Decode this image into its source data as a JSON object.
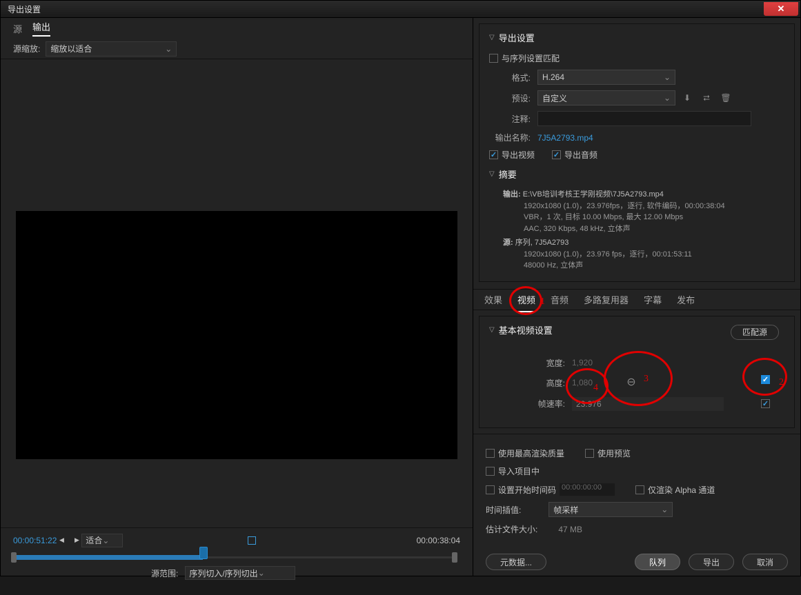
{
  "window": {
    "title": "导出设置"
  },
  "left": {
    "tabs": {
      "src": "源",
      "out": "输出"
    },
    "zoomLabel": "源缩放:",
    "zoomValue": "缩放以适合",
    "timeLeft": "00:00:51:22",
    "timeRight": "00:00:38:04",
    "fit": "适合",
    "rangeLabel": "源范围:",
    "rangeValue": "序列切入/序列切出"
  },
  "export": {
    "heading": "导出设置",
    "matchSeq": "与序列设置匹配",
    "formatLabel": "格式:",
    "formatValue": "H.264",
    "presetLabel": "预设:",
    "presetValue": "自定义",
    "commentLabel": "注释:",
    "outNameLabel": "输出名称:",
    "outNameValue": "7J5A2793.mp4",
    "exportVideo": "导出视频",
    "exportAudio": "导出音频",
    "summaryHead": "摘要",
    "outL": "输出:",
    "outPath": "E:\\VB培训考核王学刚视频\\7J5A2793.mp4",
    "outLine2": "1920x1080 (1.0)，23.976fps，逐行, 软件编码，00:00:38:04",
    "outLine3": "VBR，1 次, 目标 10.00 Mbps, 最大 12.00 Mbps",
    "outLine4": "AAC, 320 Kbps, 48 kHz, 立体声",
    "srcL": "源:",
    "srcLine1": "序列, 7J5A2793",
    "srcLine2": "1920x1080 (1.0)，23.976 fps，逐行，00:01:53:11",
    "srcLine3": "48000 Hz, 立体声"
  },
  "tabs2": {
    "effect": "效果",
    "video": "视频",
    "audio": "音频",
    "mux": "多路复用器",
    "caption": "字幕",
    "publish": "发布"
  },
  "video": {
    "heading": "基本视频设置",
    "matchSource": "匹配源",
    "widthLabel": "宽度:",
    "widthValue": "1,920",
    "heightLabel": "高度:",
    "heightValue": "1,080",
    "fpsLabel": "帧速率:",
    "fpsValue": "23.976"
  },
  "annot": {
    "n1": "1",
    "n2": "2",
    "n3": "3",
    "n4": "4"
  },
  "bottom": {
    "maxQual": "使用最高渲染质量",
    "usePreview": "使用预览",
    "importProj": "导入项目中",
    "setTc": "设置开始时间码",
    "tcVal": "00:00:00:00",
    "alphaOnly": "仅渲染 Alpha 通道",
    "interpLabel": "时间插值:",
    "interpValue": "帧采样",
    "estLabel": "估计文件大小:",
    "estValue": "47 MB",
    "metaBtn": "元数据...",
    "queueBtn": "队列",
    "exportBtn": "导出",
    "cancelBtn": "取消"
  }
}
